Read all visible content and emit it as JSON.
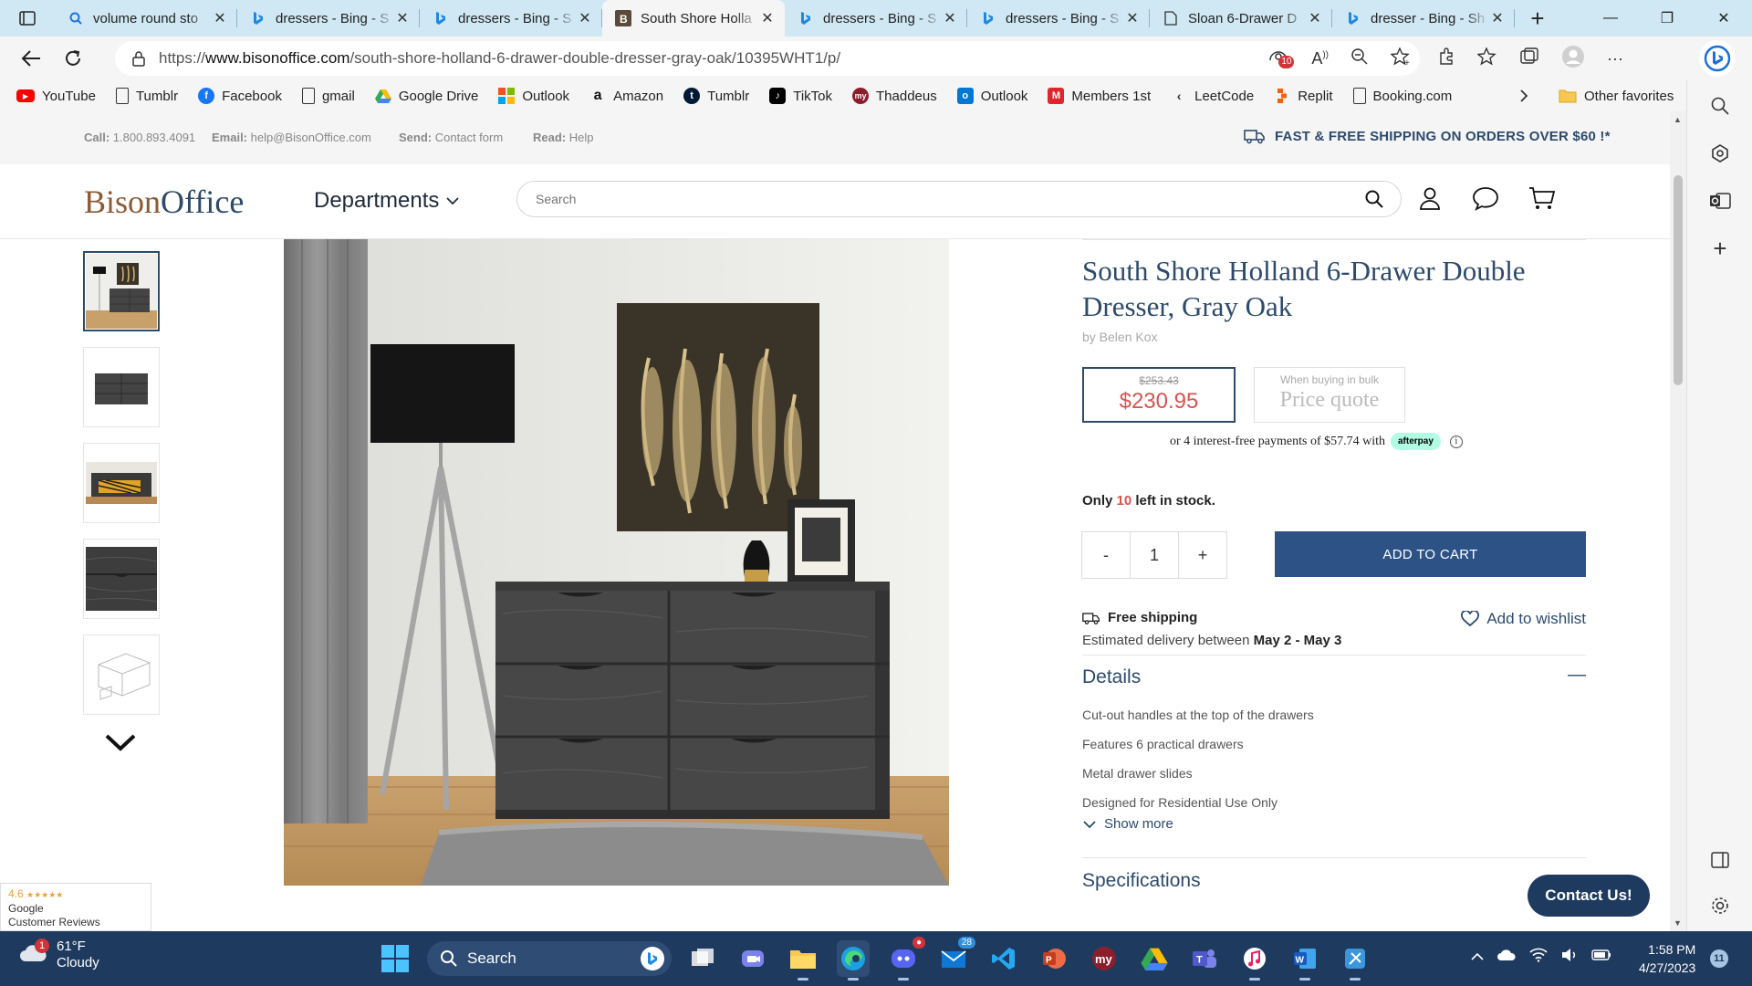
{
  "browser": {
    "tabs": [
      {
        "title": "volume round sto",
        "icon": "search-icon"
      },
      {
        "title": "dressers - Bing - S",
        "icon": "bing-icon"
      },
      {
        "title": "dressers - Bing - S",
        "icon": "bing-icon"
      },
      {
        "title": "South Shore Holla",
        "icon": "bisonoffice-icon",
        "active": true
      },
      {
        "title": "dressers - Bing - S",
        "icon": "bing-icon"
      },
      {
        "title": "dressers - Bing - S",
        "icon": "bing-icon"
      },
      {
        "title": "Sloan 6-Drawer D",
        "icon": "page-icon"
      },
      {
        "title": "dresser - Bing - Sh",
        "icon": "bing-icon"
      }
    ],
    "url": {
      "prefix": "https://",
      "domain": "www.bisonoffice.com",
      "path": "/south-shore-holland-6-drawer-double-dresser-gray-oak/10395WHT1/p/"
    },
    "tracker_count": "10",
    "favorites": [
      {
        "label": "YouTube",
        "icon": "youtube-icon",
        "color": "#ff0000"
      },
      {
        "label": "Tumblr",
        "icon": "page-icon",
        "color": "#ffffff"
      },
      {
        "label": "Facebook",
        "icon": "facebook-icon",
        "color": "#1877f2"
      },
      {
        "label": "gmail",
        "icon": "page-icon",
        "color": "#ffffff"
      },
      {
        "label": "Google Drive",
        "icon": "google-drive-icon",
        "color": "#34a853"
      },
      {
        "label": "Outlook",
        "icon": "microsoft-icon",
        "color": "#f25022"
      },
      {
        "label": "Amazon",
        "icon": "amazon-icon",
        "color": "#ffffff"
      },
      {
        "label": "Tumblr",
        "icon": "tumblr-icon",
        "color": "#001935"
      },
      {
        "label": "TikTok",
        "icon": "tiktok-icon",
        "color": "#000000"
      },
      {
        "label": "Thaddeus",
        "icon": "my-icon",
        "color": "#8b1e2d"
      },
      {
        "label": "Outlook",
        "icon": "outlook-icon",
        "color": "#0078d4"
      },
      {
        "label": "Members 1st",
        "icon": "m-icon",
        "color": "#e0262d"
      },
      {
        "label": "LeetCode",
        "icon": "leetcode-icon",
        "color": "#ffffff"
      },
      {
        "label": "Replit",
        "icon": "replit-icon",
        "color": "#f26207"
      },
      {
        "label": "Booking.com",
        "icon": "page-icon",
        "color": "#ffffff"
      }
    ],
    "other_favorites": "Other favorites"
  },
  "site": {
    "topbar": {
      "call_label": "Call:",
      "call_value": "1.800.893.4091",
      "email_label": "Email:",
      "email_value": "help@BisonOffice.com",
      "send_label": "Send:",
      "send_value": "Contact form",
      "read_label": "Read:",
      "read_value": "Help",
      "shipping_note": "FAST & FREE SHIPPING ON ORDERS OVER $60 !*"
    },
    "logo_part1": "Bison",
    "logo_part2": "Office",
    "departments": "Departments",
    "search_placeholder": "Search"
  },
  "product": {
    "title": "South Shore Holland 6-Drawer Double Dresser, Gray Oak",
    "by": "by Belen Kox",
    "old_price": "$253.43",
    "price": "$230.95",
    "bulk_label": "When buying in bulk",
    "bulk_value": "Price quote",
    "afterpay_text": "or 4 interest-free payments of $57.74 with",
    "afterpay_badge": "afterpay",
    "stock_prefix": "Only",
    "stock_count": "10",
    "stock_suffix": "left in stock.",
    "qty_minus": "-",
    "qty_value": "1",
    "qty_plus": "+",
    "add_to_cart": "ADD TO CART",
    "free_shipping": "Free shipping",
    "delivery_prefix": "Estimated delivery between",
    "delivery_range": "May 2 - May 3",
    "wishlist": "Add to wishlist",
    "details_heading": "Details",
    "details_toggle": "—",
    "details": [
      "Cut-out handles at the top of the drawers",
      "Features 6 practical drawers",
      "Metal drawer slides",
      "Designed for Residential Use Only"
    ],
    "show_more": "Show more",
    "specs_heading": "Specifications"
  },
  "contact_button": "Contact Us!",
  "reviews_widget": {
    "score": "4.6",
    "stars": "★★★★★",
    "line1": "Google",
    "line2": "Customer Reviews"
  },
  "taskbar": {
    "weather_temp": "61°F",
    "weather_cond": "Cloudy",
    "weather_badge": "1",
    "search_label": "Search",
    "mail_count": "28",
    "time": "1:58 PM",
    "date": "4/27/2023",
    "notification_count": "11"
  },
  "colors": {
    "brand_blue": "#2d4a6b",
    "brand_brown": "#8c5a34",
    "sale_red": "#d9534f",
    "cart_button": "#2d5286",
    "taskbar": "#1f3a5f"
  }
}
